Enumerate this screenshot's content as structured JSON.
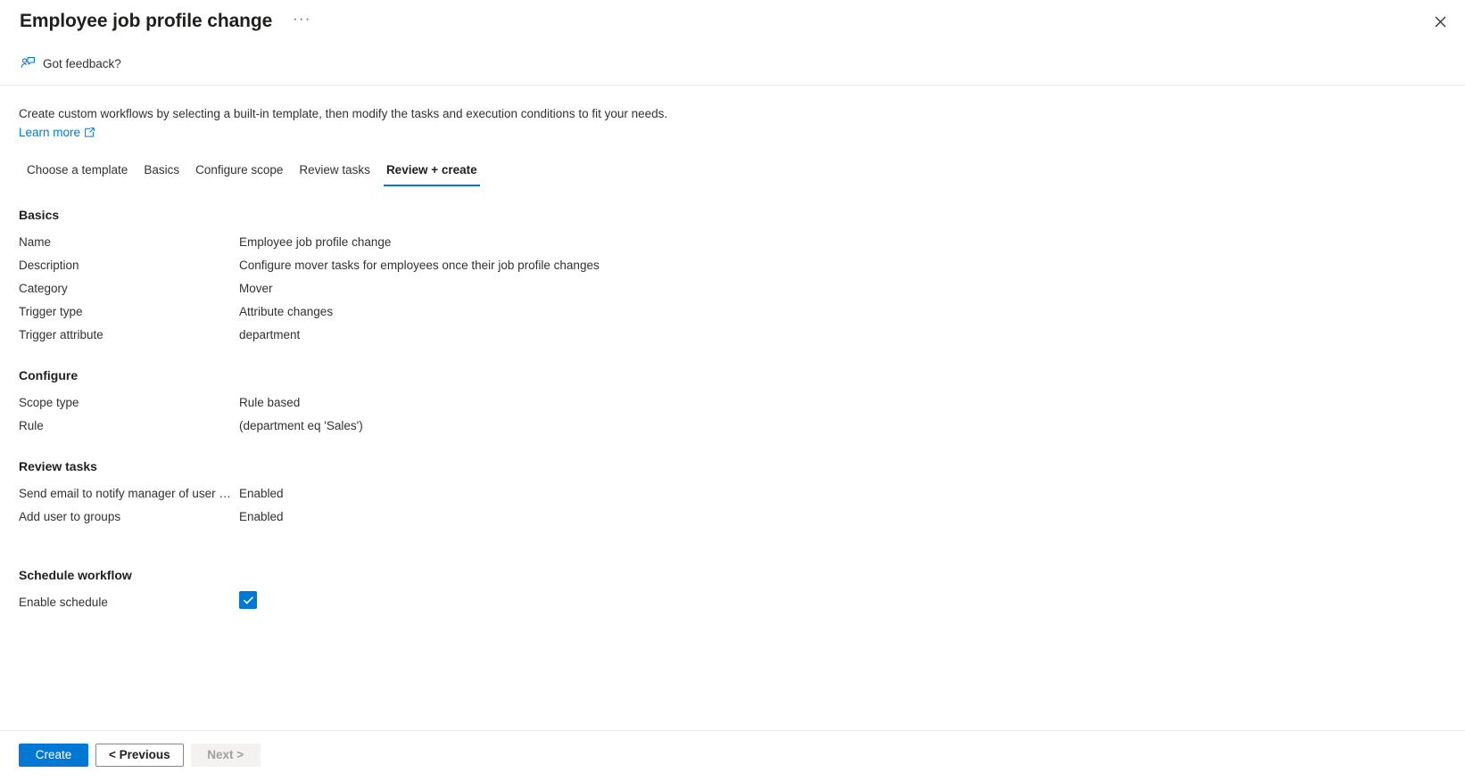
{
  "header": {
    "title": "Employee job profile change",
    "more_menu_label": "···",
    "close_label": "Close"
  },
  "commandbar": {
    "feedback_label": "Got feedback?"
  },
  "intro": {
    "text": "Create custom workflows by selecting a built-in template, then modify the tasks and execution conditions to fit your needs.",
    "learn_more_label": "Learn more"
  },
  "tabs": [
    {
      "label": "Choose a template",
      "active": false
    },
    {
      "label": "Basics",
      "active": false
    },
    {
      "label": "Configure scope",
      "active": false
    },
    {
      "label": "Review tasks",
      "active": false
    },
    {
      "label": "Review + create",
      "active": true
    }
  ],
  "sections": [
    {
      "title": "Basics",
      "rows": [
        {
          "label": "Name",
          "value": "Employee job profile change"
        },
        {
          "label": "Description",
          "value": "Configure mover tasks for employees once their job profile changes"
        },
        {
          "label": "Category",
          "value": "Mover"
        },
        {
          "label": "Trigger type",
          "value": "Attribute changes"
        },
        {
          "label": "Trigger attribute",
          "value": "department"
        }
      ]
    },
    {
      "title": "Configure",
      "rows": [
        {
          "label": "Scope type",
          "value": "Rule based"
        },
        {
          "label": "Rule",
          "value": "(department eq 'Sales')"
        }
      ]
    },
    {
      "title": "Review tasks",
      "rows": [
        {
          "label": "Send email to notify manager of user mo…",
          "value": "Enabled"
        },
        {
          "label": "Add user to groups",
          "value": "Enabled"
        }
      ]
    }
  ],
  "schedule": {
    "title": "Schedule workflow",
    "enable_label": "Enable schedule",
    "enabled": true
  },
  "footer": {
    "create_label": "Create",
    "previous_label": "< Previous",
    "next_label": "Next >"
  },
  "colors": {
    "accent": "#0078d4",
    "text": "#323130",
    "border": "#edebe9"
  }
}
